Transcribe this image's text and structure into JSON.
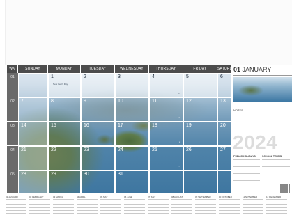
{
  "header": {
    "wk": "WK",
    "days": [
      "SUNDAY",
      "MONDAY",
      "TUESDAY",
      "WEDNESDAY",
      "THURSDAY",
      "FRIDAY",
      "SATURDAY"
    ]
  },
  "weeks": [
    {
      "wk": "01",
      "days": [
        "",
        "1",
        "2",
        "3",
        "4",
        "5",
        "6"
      ]
    },
    {
      "wk": "02",
      "days": [
        "7",
        "8",
        "9",
        "10",
        "11",
        "12",
        "13"
      ]
    },
    {
      "wk": "03",
      "days": [
        "14",
        "15",
        "16",
        "17",
        "18",
        "19",
        "20"
      ]
    },
    {
      "wk": "04",
      "days": [
        "21",
        "22",
        "23",
        "24",
        "25",
        "26",
        "27"
      ]
    },
    {
      "wk": "05",
      "days": [
        "28",
        "29",
        "30",
        "31",
        "",
        "",
        ""
      ]
    }
  ],
  "notes_in_cells": {
    "jan1": "New Year's Day"
  },
  "side": {
    "month_num": "01",
    "month_name": "JANUARY",
    "notes": "NOTES",
    "year": "2024",
    "public_holidays": "PUBLIC HOLIDAYS",
    "school_terms": "SCHOOL TERMS"
  },
  "mini_months": [
    "01 JANUARY",
    "02 FEBRUARY",
    "03 MARCH",
    "04 APRIL",
    "05 MAY",
    "06 JUNE",
    "07 JULY",
    "08 AUGUST",
    "09 SEPTEMBER",
    "10 OCTOBER",
    "11 NOVEMBER",
    "12 DECEMBER"
  ]
}
